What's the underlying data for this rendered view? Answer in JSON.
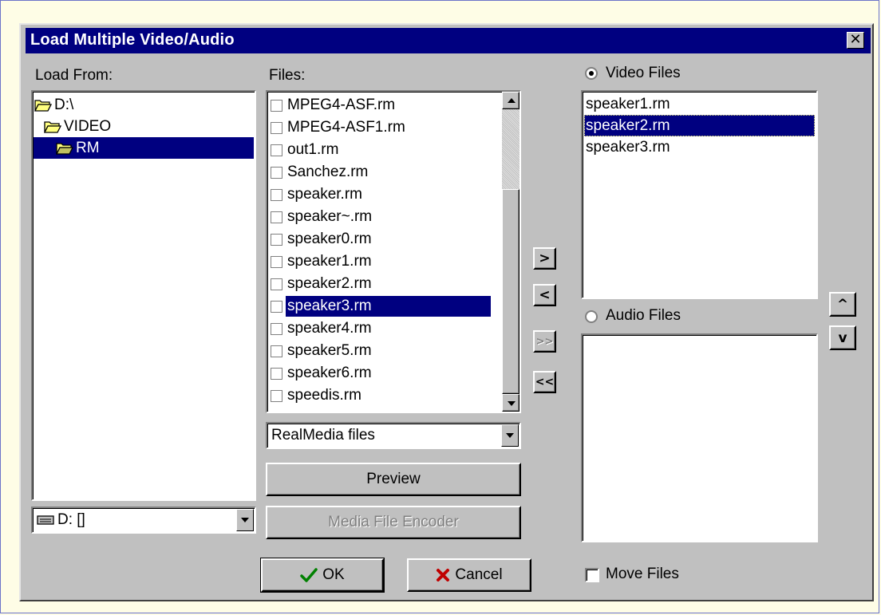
{
  "window": {
    "title": "Load Multiple Video/Audio",
    "close_glyph": "✕"
  },
  "load_from": {
    "label": "Load From:",
    "tree": [
      {
        "label": "D:\\",
        "icon": "open-folder-icon"
      },
      {
        "label": "VIDEO",
        "icon": "open-folder-icon"
      },
      {
        "label": "RM",
        "icon": "open-folder-icon",
        "selected": true
      }
    ],
    "drive": {
      "value": "D: []",
      "icon": "drive-icon"
    }
  },
  "files": {
    "label": "Files:",
    "items": [
      "MPEG4-ASF.rm",
      "MPEG4-ASF1.rm",
      "out1.rm",
      "Sanchez.rm",
      "speaker.rm",
      "speaker~.rm",
      "speaker0.rm",
      "speaker1.rm",
      "speaker2.rm",
      "speaker3.rm",
      "speaker4.rm",
      "speaker5.rm",
      "speaker6.rm",
      "speedis.rm"
    ],
    "selected_index": 9,
    "filter_value": "RealMedia files"
  },
  "buttons": {
    "preview": "Preview",
    "media_encoder": "Media File Encoder",
    "ok": "OK",
    "cancel": "Cancel",
    "add": ">",
    "remove": "<",
    "add_all": ">>",
    "remove_all": "<<",
    "move_up": "^",
    "move_down": "v"
  },
  "video": {
    "label": "Video Files",
    "items": [
      "speaker1.rm",
      "speaker2.rm",
      "speaker3.rm"
    ],
    "selected_index": 1
  },
  "audio": {
    "label": "Audio Files",
    "items": []
  },
  "move_files": {
    "label": "Move Files",
    "checked": false
  },
  "colors": {
    "selection": "#000080",
    "dialog_bg": "#c0c0c0",
    "page_bg": "#fefde6"
  }
}
